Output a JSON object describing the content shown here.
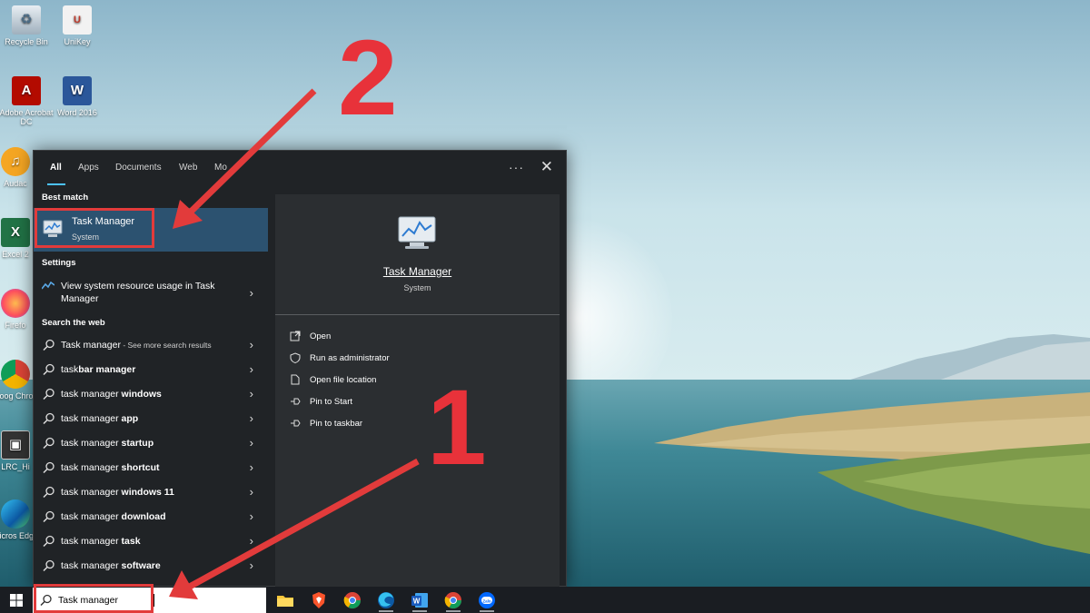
{
  "desktop_icons": [
    {
      "name": "recycle-bin",
      "label": "Recycle Bin"
    },
    {
      "name": "unikey",
      "label": "UniKey"
    },
    {
      "name": "adobe-acrobat",
      "label": "Adobe Acrobat DC"
    },
    {
      "name": "word-2016",
      "label": "Word 2016"
    },
    {
      "name": "audacity",
      "label": "Audac"
    },
    {
      "name": "excel",
      "label": "Excel 2"
    },
    {
      "name": "firefox",
      "label": "Firefo"
    },
    {
      "name": "google-chrome",
      "label": "Goog Chron"
    },
    {
      "name": "lrc",
      "label": "LRC_Hi"
    },
    {
      "name": "microsoft-edge",
      "label": "Micros Edge"
    }
  ],
  "search_panel": {
    "tabs": [
      "All",
      "Apps",
      "Documents",
      "Web",
      "Mo"
    ],
    "more_label": "···",
    "close_label": "✕",
    "best_match": {
      "section": "Best match",
      "title": "Task Manager",
      "subtitle": "System"
    },
    "settings": {
      "section": "Settings",
      "item": "View system resource usage in Task Manager"
    },
    "web": {
      "section": "Search the web",
      "first": {
        "query": "Task manager",
        "suffix": " - See more search results"
      },
      "items": [
        {
          "prefix": "task",
          "bold": "bar manager"
        },
        {
          "prefix": "task manager",
          "bold": " windows"
        },
        {
          "prefix": "task manager",
          "bold": " app"
        },
        {
          "prefix": "task manager",
          "bold": " startup"
        },
        {
          "prefix": "task manager",
          "bold": " shortcut"
        },
        {
          "prefix": "task manager",
          "bold": " windows 11"
        },
        {
          "prefix": "task manager",
          "bold": " download"
        },
        {
          "prefix": "task manager",
          "bold": " task"
        },
        {
          "prefix": "task manager",
          "bold": " software"
        }
      ]
    },
    "preview": {
      "title": "Task Manager",
      "subtitle": "System",
      "actions": [
        "Open",
        "Run as administrator",
        "Open file location",
        "Pin to Start",
        "Pin to taskbar"
      ]
    }
  },
  "taskbar": {
    "search_value": "Task manager",
    "apps": [
      "file-explorer",
      "brave",
      "chrome",
      "edge",
      "word",
      "chrome",
      "zalo"
    ]
  },
  "annotations": {
    "step1": "1",
    "step2": "2"
  },
  "colors": {
    "panel_bg": "#202326",
    "highlight": "#2c5270",
    "accent": "#4cc2ff",
    "annotation_red": "#e23b3b"
  }
}
